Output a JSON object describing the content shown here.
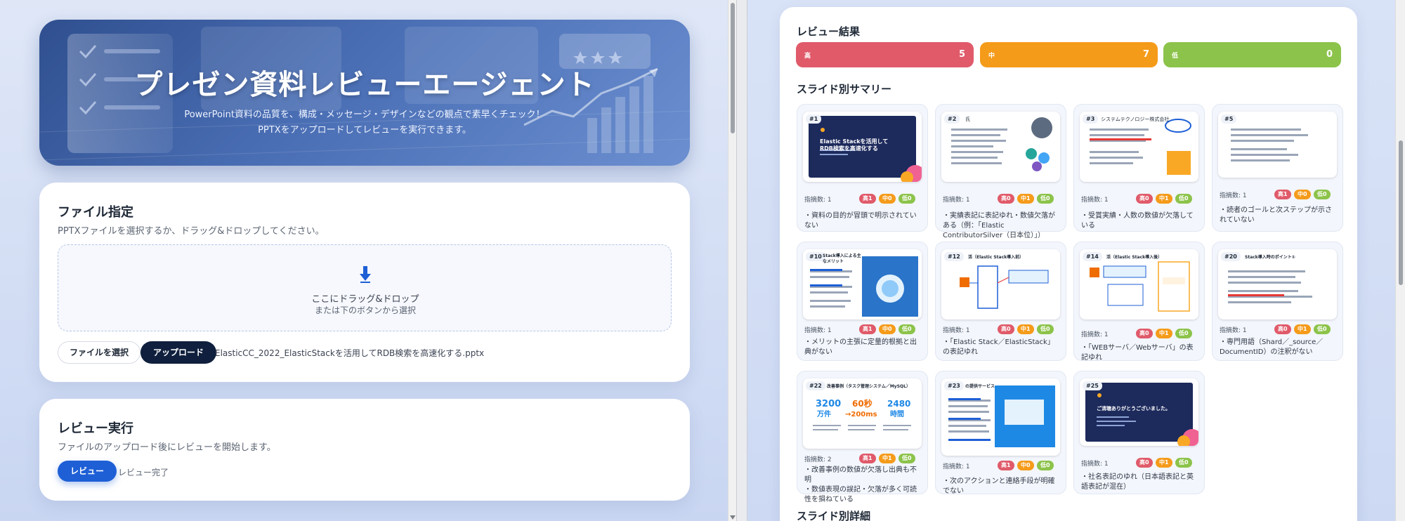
{
  "hero": {
    "title": "プレゼン資料レビューエージェント",
    "subtitle_line1": "PowerPoint資料の品質を、構成・メッセージ・デザインなどの観点で素早くチェック！",
    "subtitle_line2": "PPTXをアップロードしてレビューを実行できます。"
  },
  "file_section": {
    "title": "ファイル指定",
    "description": "PPTXファイルを選択するか、ドラッグ&ドロップしてください。",
    "dropzone_line1": "ここにドラッグ&ドロップ",
    "dropzone_line2": "または下のボタンから選択",
    "select_button": "ファイルを選択",
    "upload_button": "アップロード",
    "filename": "ElasticCC_2022_ElasticStackを活用してRDB検索を高速化する.pptx"
  },
  "review_section": {
    "title": "レビュー実行",
    "description": "ファイルのアップロード後にレビューを開始します。",
    "review_button": "レビュー",
    "status": "レビュー完了"
  },
  "results": {
    "title": "レビュー結果",
    "severity": [
      {
        "label": "高",
        "count": "5",
        "color": "#e05a6a"
      },
      {
        "label": "中",
        "count": "7",
        "color": "#f59b1a"
      },
      {
        "label": "低",
        "count": "0",
        "color": "#8cc34a"
      }
    ],
    "summary_title": "スライド別サマリー",
    "detail_title": "スライド別詳細",
    "slides": [
      {
        "no": "#1",
        "count": "指摘数: 1",
        "high": "高1",
        "mid": "中0",
        "low": "低0",
        "text": "・資料の目的が冒頭で明示されていない",
        "thumb_title": "Elastic Stackを活用してRDB検索を高速化する"
      },
      {
        "no": "#2",
        "count": "指摘数: 1",
        "high": "高0",
        "mid": "中1",
        "low": "低0",
        "text": "・実績表記に表記ゆれ・数値欠落がある（例：「Elastic ContributorSilver（日本位）」）",
        "thumb_title": "氏"
      },
      {
        "no": "#3",
        "count": "指摘数: 1",
        "high": "高0",
        "mid": "中1",
        "low": "低0",
        "text": "・受賞実績・人数の数値が欠落している",
        "thumb_title": "システムテクノロジー株式会社"
      },
      {
        "no": "#5",
        "count": "指摘数: 1",
        "high": "高1",
        "mid": "中0",
        "low": "低0",
        "text": "・読者のゴールと次ステップが示されていない",
        "thumb_title": ""
      },
      {
        "no": "#10",
        "count": "指摘数: 1",
        "high": "高1",
        "mid": "中0",
        "low": "低0",
        "text": "・メリットの主張に定量的根拠と出典がない",
        "thumb_title": "Stack導入による主なメリット"
      },
      {
        "no": "#12",
        "count": "指摘数: 1",
        "high": "高0",
        "mid": "中1",
        "low": "低0",
        "text": "・「Elastic Stack／ElasticStack」の表記ゆれ",
        "thumb_title": "活（Elastic Stack導入前）"
      },
      {
        "no": "#14",
        "count": "指摘数: 1",
        "high": "高0",
        "mid": "中1",
        "low": "低0",
        "text": "・「WEBサーバ／Webサーバ」の表記ゆれ",
        "thumb_title": "活（Elastic Stack導入後）"
      },
      {
        "no": "#20",
        "count": "指摘数: 1",
        "high": "高0",
        "mid": "中1",
        "low": "低0",
        "text": "・専門用語（Shard／_source／DocumentID）の注釈がない",
        "thumb_title": "Stack導入時のポイント①"
      },
      {
        "no": "#22",
        "count": "指摘数: 2",
        "high": "高1",
        "mid": "中1",
        "low": "低0",
        "text": "・改善事例の数値が欠落し出典も不明\n・数値表現の誤記・欠落が多く可読性を損ねている",
        "thumb_title": "改善事例（タスク管理システム／MySQL）"
      },
      {
        "no": "#23",
        "count": "指摘数: 1",
        "high": "高1",
        "mid": "中0",
        "low": "低0",
        "text": "・次のアクションと連絡手段が明確でない",
        "thumb_title": "の提供サービス"
      },
      {
        "no": "#25",
        "count": "指摘数: 1",
        "high": "高0",
        "mid": "中1",
        "low": "低0",
        "text": "・社名表記のゆれ（日本語表記と英語表記が混在）",
        "thumb_title": "ご清聴ありがとうございました。"
      }
    ]
  }
}
